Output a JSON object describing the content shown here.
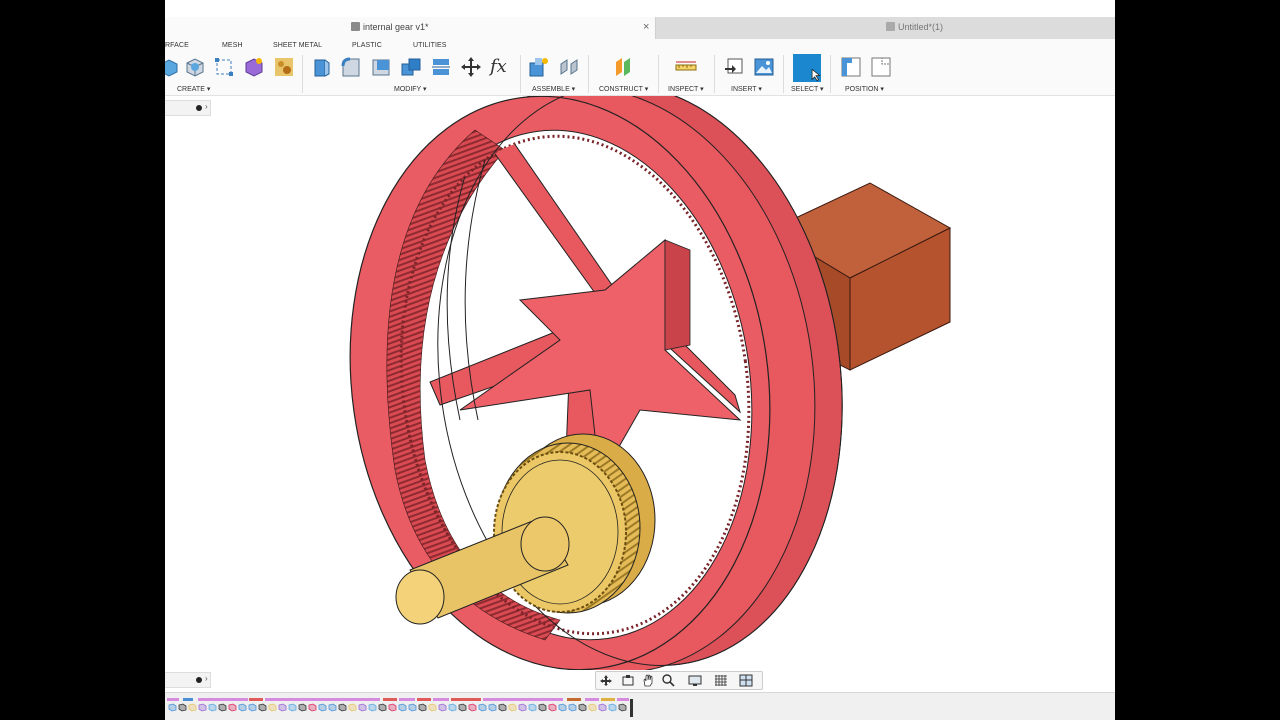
{
  "window": {
    "active_tab": "internal gear v1*",
    "inactive_tab": "Untitled*(1)",
    "close_glyph": "×"
  },
  "toolbar": {
    "workspace_tabs": [
      "RFACE",
      "MESH",
      "SHEET METAL",
      "PLASTIC",
      "UTILITIES"
    ],
    "groups": [
      {
        "label": "CREATE ▾",
        "icons": [
          "surface-extrude-icon",
          "box-icon",
          "sketch-icon",
          "sphere-icon",
          "texture-icon"
        ]
      },
      {
        "label": "MODIFY ▾",
        "icons": [
          "press-pull-icon",
          "fillet-icon",
          "shell-icon",
          "combine-icon",
          "align-icon",
          "move-icon",
          "parameters-icon"
        ]
      },
      {
        "label": "ASSEMBLE ▾",
        "icons": [
          "new-component-icon",
          "joint-icon"
        ]
      },
      {
        "label": "CONSTRUCT ▾",
        "icons": [
          "offset-plane-icon"
        ]
      },
      {
        "label": "INSPECT ▾",
        "icons": [
          "measure-icon"
        ]
      },
      {
        "label": "INSERT ▾",
        "icons": [
          "insert-derive-icon",
          "insert-image-icon"
        ]
      },
      {
        "label": "SELECT ▾",
        "icons": [
          "select-icon"
        ]
      },
      {
        "label": "POSITION ▾",
        "icons": [
          "capture-position-icon",
          "revert-position-icon"
        ]
      }
    ],
    "fx_label": "fx"
  },
  "panels": {
    "browser_chevron": "›",
    "comments_chevron": "›"
  },
  "navbar": {
    "icons": [
      "orbit-icon",
      "look-at-icon",
      "pan-icon",
      "zoom-icon",
      "display-settings-icon",
      "grid-icon",
      "viewports-icon"
    ]
  },
  "timeline": {
    "item_count": 46
  },
  "colors": {
    "ring_gear": "#e8585f",
    "pinion": "#e9c467",
    "block": "#b5532f",
    "select_active": "#1b87cf"
  }
}
